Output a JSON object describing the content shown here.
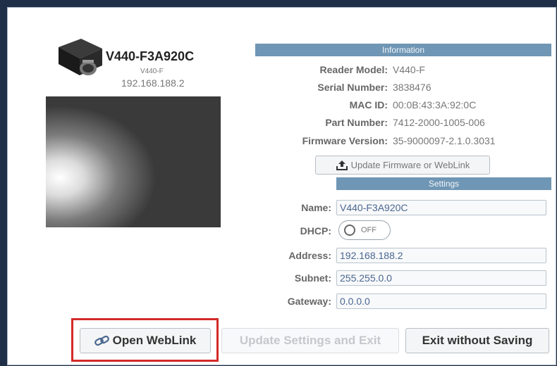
{
  "device": {
    "title": "V440-F3A920C",
    "model": "V440-F",
    "ip": "192.168.188.2"
  },
  "information": {
    "header": "Information",
    "rows": [
      {
        "label": "Reader Model:",
        "value": "V440-F"
      },
      {
        "label": "Serial Number:",
        "value": "3838476"
      },
      {
        "label": "MAC ID:",
        "value": "00:0B:43:3A:92:0C"
      },
      {
        "label": "Part Number:",
        "value": "7412-2000-1005-006"
      },
      {
        "label": "Firmware Version:",
        "value": "35-9000097-2.1.0.3031"
      }
    ],
    "update_button": "Update Firmware or WebLink"
  },
  "settings": {
    "header": "Settings",
    "name_label": "Name:",
    "name_value": "V440-F3A920C",
    "dhcp_label": "DHCP:",
    "dhcp_state": "OFF",
    "address_label": "Address:",
    "address_value": "192.168.188.2",
    "subnet_label": "Subnet:",
    "subnet_value": "255.255.0.0",
    "gateway_label": "Gateway:",
    "gateway_value": "0.0.0.0"
  },
  "buttons": {
    "open_weblink": "Open WebLink",
    "update_exit": "Update Settings and Exit",
    "exit_no_save": "Exit without Saving"
  },
  "colors": {
    "section_bar": "#6f96b4",
    "highlight": "#d42a2a",
    "field_text": "#4a6790"
  }
}
